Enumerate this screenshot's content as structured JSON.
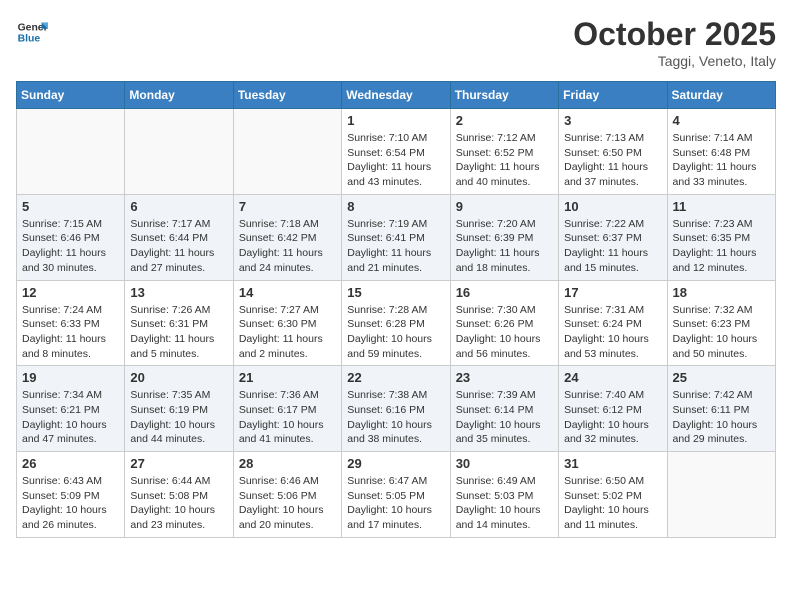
{
  "logo": {
    "general": "General",
    "blue": "Blue"
  },
  "header": {
    "month": "October 2025",
    "location": "Taggi, Veneto, Italy"
  },
  "weekdays": [
    "Sunday",
    "Monday",
    "Tuesday",
    "Wednesday",
    "Thursday",
    "Friday",
    "Saturday"
  ],
  "weeks": [
    [
      {
        "day": "",
        "info": ""
      },
      {
        "day": "",
        "info": ""
      },
      {
        "day": "",
        "info": ""
      },
      {
        "day": "1",
        "info": "Sunrise: 7:10 AM\nSunset: 6:54 PM\nDaylight: 11 hours and 43 minutes."
      },
      {
        "day": "2",
        "info": "Sunrise: 7:12 AM\nSunset: 6:52 PM\nDaylight: 11 hours and 40 minutes."
      },
      {
        "day": "3",
        "info": "Sunrise: 7:13 AM\nSunset: 6:50 PM\nDaylight: 11 hours and 37 minutes."
      },
      {
        "day": "4",
        "info": "Sunrise: 7:14 AM\nSunset: 6:48 PM\nDaylight: 11 hours and 33 minutes."
      }
    ],
    [
      {
        "day": "5",
        "info": "Sunrise: 7:15 AM\nSunset: 6:46 PM\nDaylight: 11 hours and 30 minutes."
      },
      {
        "day": "6",
        "info": "Sunrise: 7:17 AM\nSunset: 6:44 PM\nDaylight: 11 hours and 27 minutes."
      },
      {
        "day": "7",
        "info": "Sunrise: 7:18 AM\nSunset: 6:42 PM\nDaylight: 11 hours and 24 minutes."
      },
      {
        "day": "8",
        "info": "Sunrise: 7:19 AM\nSunset: 6:41 PM\nDaylight: 11 hours and 21 minutes."
      },
      {
        "day": "9",
        "info": "Sunrise: 7:20 AM\nSunset: 6:39 PM\nDaylight: 11 hours and 18 minutes."
      },
      {
        "day": "10",
        "info": "Sunrise: 7:22 AM\nSunset: 6:37 PM\nDaylight: 11 hours and 15 minutes."
      },
      {
        "day": "11",
        "info": "Sunrise: 7:23 AM\nSunset: 6:35 PM\nDaylight: 11 hours and 12 minutes."
      }
    ],
    [
      {
        "day": "12",
        "info": "Sunrise: 7:24 AM\nSunset: 6:33 PM\nDaylight: 11 hours and 8 minutes."
      },
      {
        "day": "13",
        "info": "Sunrise: 7:26 AM\nSunset: 6:31 PM\nDaylight: 11 hours and 5 minutes."
      },
      {
        "day": "14",
        "info": "Sunrise: 7:27 AM\nSunset: 6:30 PM\nDaylight: 11 hours and 2 minutes."
      },
      {
        "day": "15",
        "info": "Sunrise: 7:28 AM\nSunset: 6:28 PM\nDaylight: 10 hours and 59 minutes."
      },
      {
        "day": "16",
        "info": "Sunrise: 7:30 AM\nSunset: 6:26 PM\nDaylight: 10 hours and 56 minutes."
      },
      {
        "day": "17",
        "info": "Sunrise: 7:31 AM\nSunset: 6:24 PM\nDaylight: 10 hours and 53 minutes."
      },
      {
        "day": "18",
        "info": "Sunrise: 7:32 AM\nSunset: 6:23 PM\nDaylight: 10 hours and 50 minutes."
      }
    ],
    [
      {
        "day": "19",
        "info": "Sunrise: 7:34 AM\nSunset: 6:21 PM\nDaylight: 10 hours and 47 minutes."
      },
      {
        "day": "20",
        "info": "Sunrise: 7:35 AM\nSunset: 6:19 PM\nDaylight: 10 hours and 44 minutes."
      },
      {
        "day": "21",
        "info": "Sunrise: 7:36 AM\nSunset: 6:17 PM\nDaylight: 10 hours and 41 minutes."
      },
      {
        "day": "22",
        "info": "Sunrise: 7:38 AM\nSunset: 6:16 PM\nDaylight: 10 hours and 38 minutes."
      },
      {
        "day": "23",
        "info": "Sunrise: 7:39 AM\nSunset: 6:14 PM\nDaylight: 10 hours and 35 minutes."
      },
      {
        "day": "24",
        "info": "Sunrise: 7:40 AM\nSunset: 6:12 PM\nDaylight: 10 hours and 32 minutes."
      },
      {
        "day": "25",
        "info": "Sunrise: 7:42 AM\nSunset: 6:11 PM\nDaylight: 10 hours and 29 minutes."
      }
    ],
    [
      {
        "day": "26",
        "info": "Sunrise: 6:43 AM\nSunset: 5:09 PM\nDaylight: 10 hours and 26 minutes."
      },
      {
        "day": "27",
        "info": "Sunrise: 6:44 AM\nSunset: 5:08 PM\nDaylight: 10 hours and 23 minutes."
      },
      {
        "day": "28",
        "info": "Sunrise: 6:46 AM\nSunset: 5:06 PM\nDaylight: 10 hours and 20 minutes."
      },
      {
        "day": "29",
        "info": "Sunrise: 6:47 AM\nSunset: 5:05 PM\nDaylight: 10 hours and 17 minutes."
      },
      {
        "day": "30",
        "info": "Sunrise: 6:49 AM\nSunset: 5:03 PM\nDaylight: 10 hours and 14 minutes."
      },
      {
        "day": "31",
        "info": "Sunrise: 6:50 AM\nSunset: 5:02 PM\nDaylight: 10 hours and 11 minutes."
      },
      {
        "day": "",
        "info": ""
      }
    ]
  ]
}
